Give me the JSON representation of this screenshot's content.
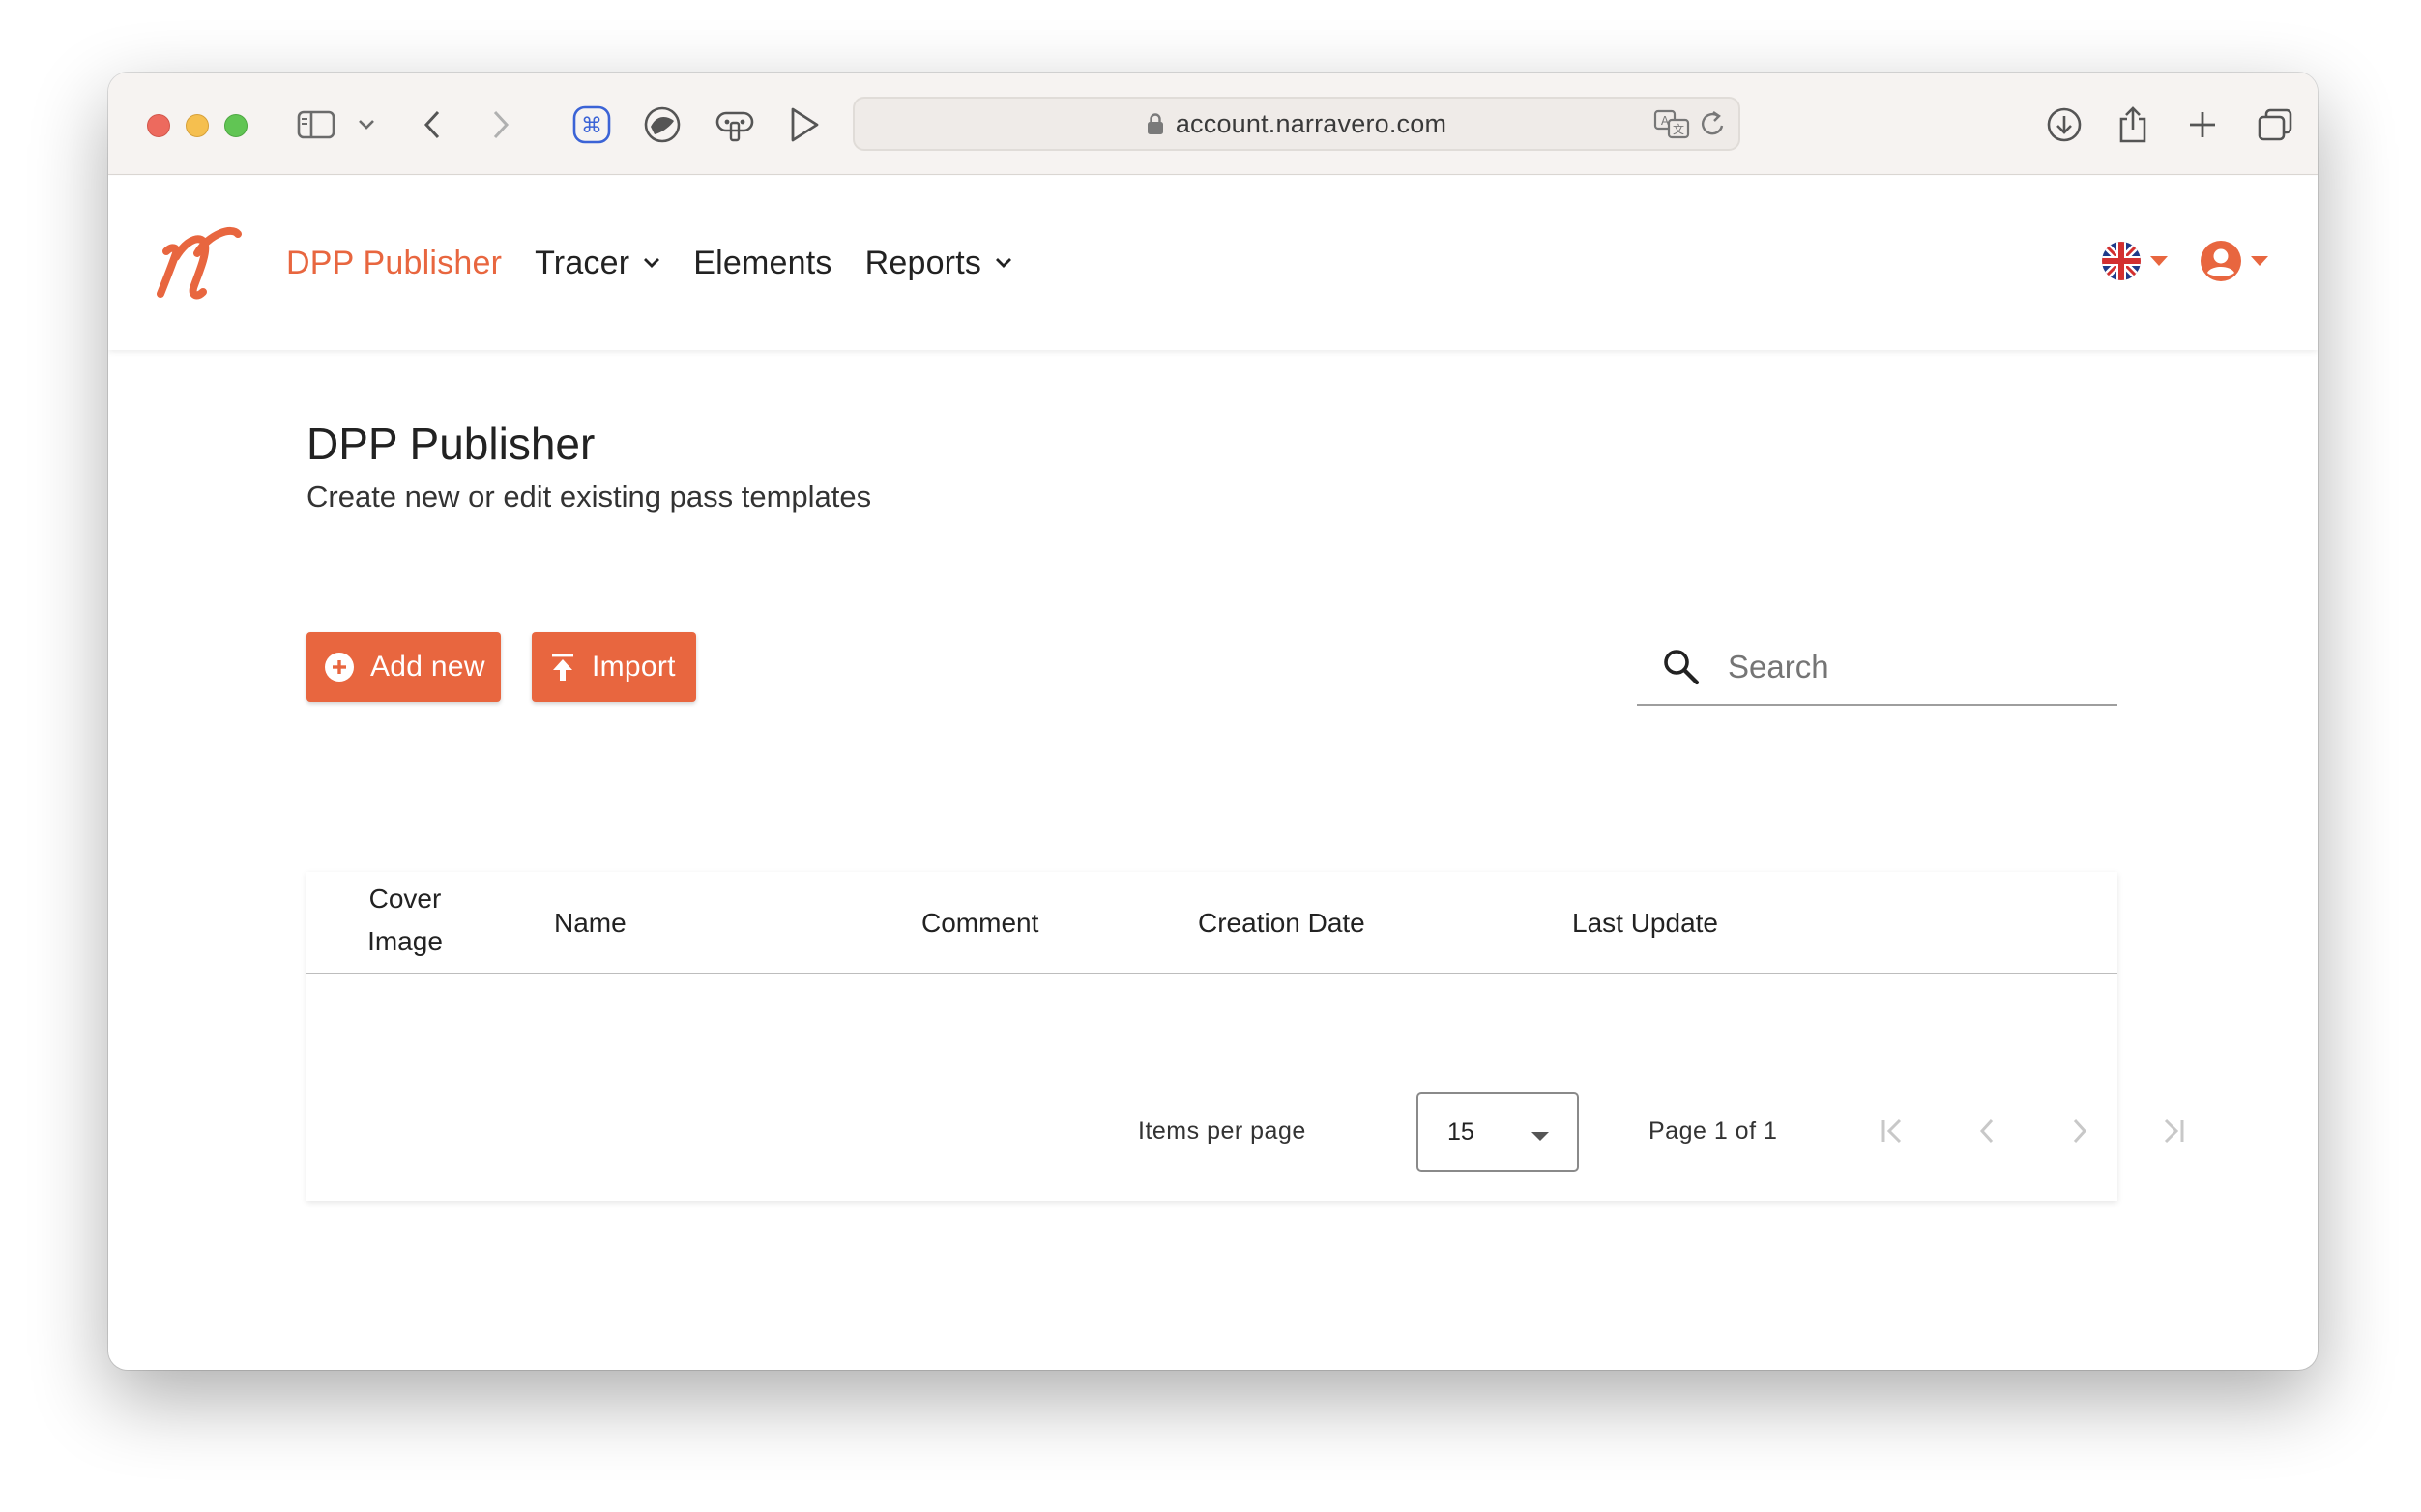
{
  "browser": {
    "url": "account.narravero.com"
  },
  "header": {
    "nav": [
      {
        "label": "DPP Publisher",
        "active": true
      },
      {
        "label": "Tracer",
        "dropdown": true
      },
      {
        "label": "Elements"
      },
      {
        "label": "Reports",
        "dropdown": true
      }
    ],
    "language_icon": "uk-flag-icon",
    "account_icon": "account-circle-icon"
  },
  "page": {
    "title": "DPP Publisher",
    "subtitle": "Create new or edit existing pass templates"
  },
  "actions": {
    "add_label": "Add new",
    "import_label": "Import"
  },
  "search": {
    "placeholder": "Search",
    "value": ""
  },
  "table": {
    "columns": {
      "cover_line1": "Cover",
      "cover_line2": "Image",
      "name": "Name",
      "comment": "Comment",
      "created": "Creation Date",
      "updated": "Last Update"
    },
    "rows": []
  },
  "pagination": {
    "items_per_page_label": "Items per page",
    "items_per_page_value": "15",
    "range_label": "Page 1 of 1"
  },
  "colors": {
    "accent": "#e8663f",
    "text": "#222222"
  }
}
